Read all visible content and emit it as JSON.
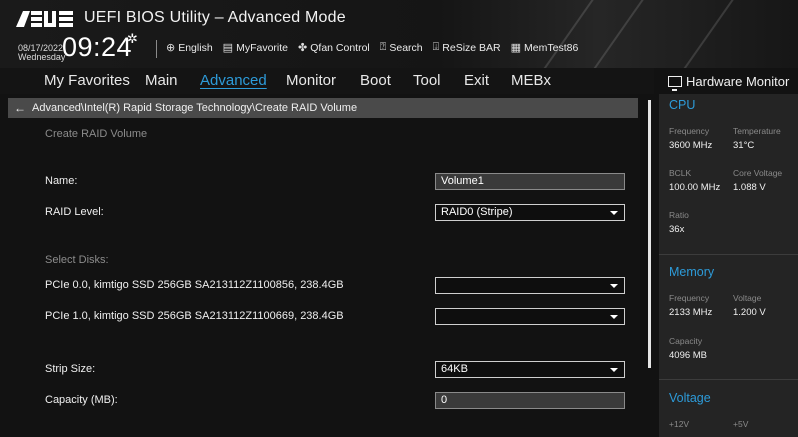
{
  "header": {
    "brand": "ASUS",
    "title": "UEFI BIOS Utility – Advanced Mode",
    "date": "08/17/2022",
    "weekday": "Wednesday",
    "time": "09:24",
    "tools": [
      {
        "label": "English",
        "icon": "globe-icon"
      },
      {
        "label": "MyFavorite",
        "icon": "favorite-icon"
      },
      {
        "label": "Qfan Control",
        "icon": "fan-icon"
      },
      {
        "label": "Search",
        "icon": "search-icon"
      },
      {
        "label": "ReSize BAR",
        "icon": "resize-bar-icon"
      },
      {
        "label": "MemTest86",
        "icon": "memtest-icon"
      }
    ]
  },
  "nav": {
    "tabs": [
      "My Favorites",
      "Main",
      "Advanced",
      "Monitor",
      "Boot",
      "Tool",
      "Exit",
      "MEBx"
    ],
    "active": "Advanced"
  },
  "breadcrumb": "Advanced\\Intel(R) Rapid Storage Technology\\Create RAID Volume",
  "main": {
    "section_title": "Create RAID Volume",
    "name_label": "Name:",
    "name_value": "Volume1",
    "raid_level_label": "RAID Level:",
    "raid_level_value": "RAID0 (Stripe)",
    "select_disks_label": "Select Disks:",
    "disks": [
      {
        "label": "PCIe 0.0, kimtigo SSD 256GB SA213112Z1100856, 238.4GB",
        "value": ""
      },
      {
        "label": "PCIe 1.0, kimtigo SSD 256GB SA213112Z1100669, 238.4GB",
        "value": ""
      }
    ],
    "strip_size_label": "Strip Size:",
    "strip_size_value": "64KB",
    "capacity_label": "Capacity (MB):",
    "capacity_value": "0"
  },
  "hw_monitor": {
    "title": "Hardware Monitor",
    "cpu": {
      "title": "CPU",
      "frequency_label": "Frequency",
      "frequency": "3600 MHz",
      "temperature_label": "Temperature",
      "temperature": "31°C",
      "bclk_label": "BCLK",
      "bclk": "100.00 MHz",
      "core_voltage_label": "Core Voltage",
      "core_voltage": "1.088 V",
      "ratio_label": "Ratio",
      "ratio": "36x"
    },
    "memory": {
      "title": "Memory",
      "frequency_label": "Frequency",
      "frequency": "2133 MHz",
      "voltage_label": "Voltage",
      "voltage": "1.200 V",
      "capacity_label": "Capacity",
      "capacity": "4096 MB"
    },
    "voltage": {
      "title": "Voltage",
      "v12_label": "+12V",
      "v5_label": "+5V"
    }
  },
  "colors": {
    "accent": "#2d9bd9",
    "background": "#121212",
    "panel": "#242424",
    "breadcrumb_bg": "#4a4a4a"
  }
}
